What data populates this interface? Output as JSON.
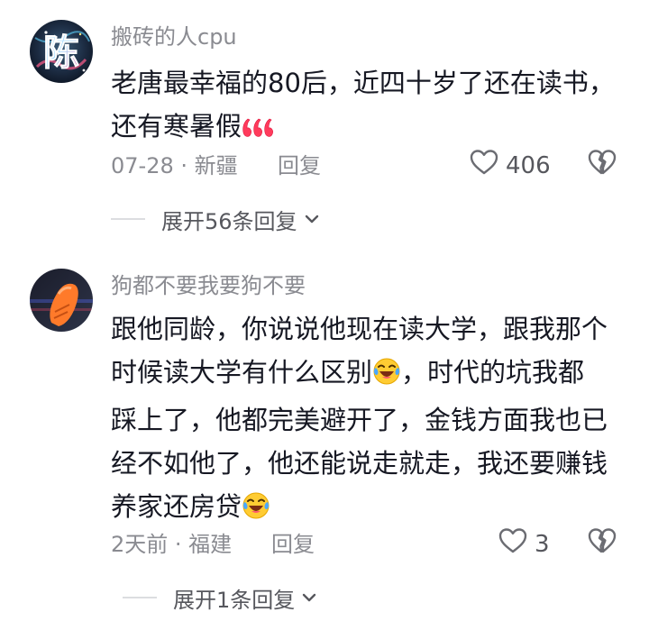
{
  "comments": [
    {
      "username": "搬砖的人cpu",
      "avatar_char": "陈",
      "text_lines": [
        "老唐最幸福的80后，近四十岁了还在读书，",
        "还有寒暑假"
      ],
      "text_emoji": "666-emoji",
      "date_location": "07-28 · 新疆",
      "reply_label": "回复",
      "like_count": "406",
      "expand_label": "展开56条回复"
    },
    {
      "username": "狗都不要我要狗不要",
      "text_lines": [
        "跟他同龄，你说说他现在读大学，跟我那个",
        "时候读大学有什么区别",
        "，时代的坑我都",
        "踩上了，他都完美避开了，金钱方面我也已",
        "经不如他了，他还能说走就走，我还要赚钱",
        "养家还房贷"
      ],
      "text_emoji": "laughing-crying-emoji",
      "date_location": "2天前 · 福建",
      "reply_label": "回复",
      "like_count": "3",
      "expand_label": "展开1条回复"
    }
  ],
  "icons": {
    "like": "heart-outline-icon",
    "dislike": "broken-heart-icon",
    "expand": "chevron-down-icon"
  },
  "colors": {
    "text": "#161823",
    "secondary": "#8a8b91",
    "icon": "#6b6c72",
    "divider": "#dcdde0",
    "emoji_666": "#ff3b5c"
  }
}
